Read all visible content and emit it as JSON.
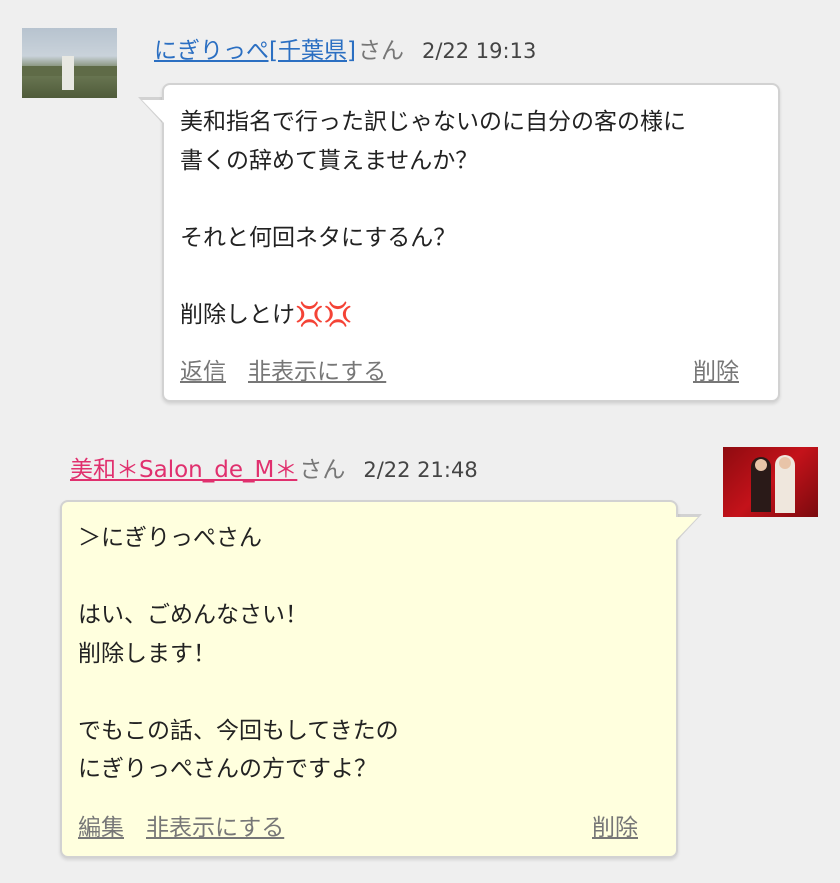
{
  "comments": [
    {
      "author": "にぎりっぺ[千葉県]",
      "honorific": "さん",
      "time": "2/22 19:13",
      "lines": [
        "美和指名で行った訳じゃないのに自分の客の様に",
        "書くの辞めて貰えませんか？",
        "",
        "それと何回ネタにするん？",
        "",
        "削除しとけ"
      ],
      "emoji": "💢💢",
      "actions": {
        "reply": "返信",
        "hide": "非表示にする",
        "delete": "削除"
      },
      "avatar_icon": "landscape-photo",
      "name_color": "#2b6fc2",
      "bubble_color": "#ffffff"
    },
    {
      "author": "美和＊Salon_de_M＊",
      "honorific": "さん",
      "time": "2/22 21:48",
      "lines": [
        "＞にぎりっぺさん",
        "",
        "はい、ごめんなさい！",
        "削除します！",
        "",
        "でもこの話、今回もしてきたの",
        "にぎりっぺさんの方ですよ？"
      ],
      "actions": {
        "edit": "編集",
        "hide": "非表示にする",
        "delete": "削除"
      },
      "avatar_icon": "two-women-photo",
      "name_color": "#e0306e",
      "bubble_color": "#ffffde"
    }
  ]
}
